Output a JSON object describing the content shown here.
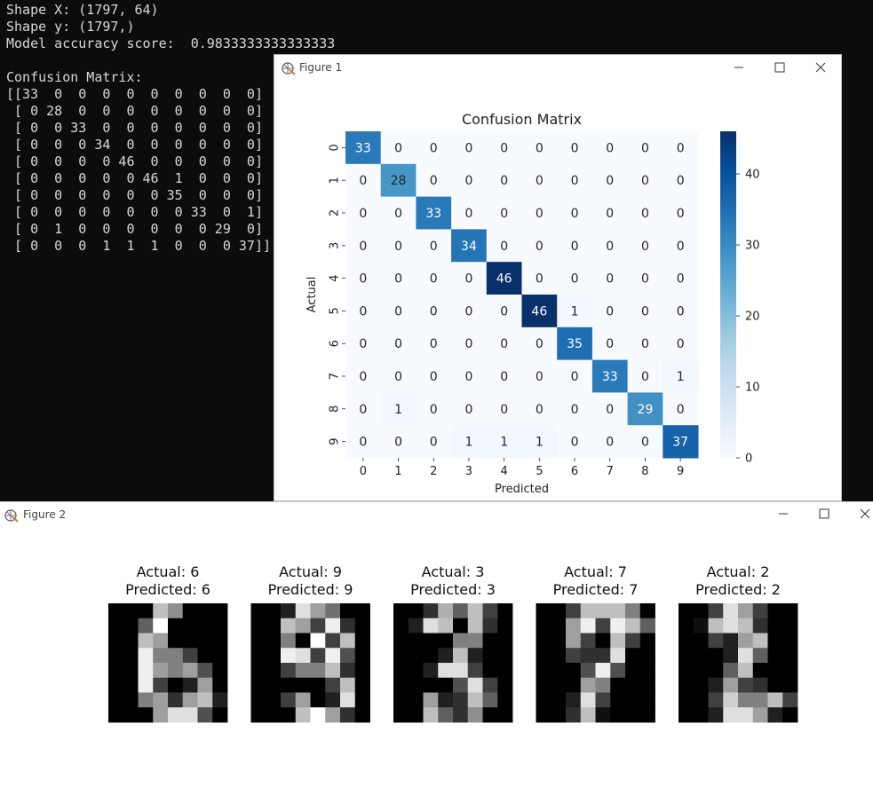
{
  "terminal": {
    "lines": [
      "Shape X: (1797, 64)",
      "Shape y: (1797,)",
      "Model accuracy score:  0.9833333333333333",
      "",
      "Confusion Matrix:",
      "[[33  0  0  0  0  0  0  0  0  0]",
      " [ 0 28  0  0  0  0  0  0  0  0]",
      " [ 0  0 33  0  0  0  0  0  0  0]",
      " [ 0  0  0 34  0  0  0  0  0  0]",
      " [ 0  0  0  0 46  0  0  0  0  0]",
      " [ 0  0  0  0  0 46  1  0  0  0]",
      " [ 0  0  0  0  0  0 35  0  0  0]",
      " [ 0  0  0  0  0  0  0 33  0  1]",
      " [ 0  1  0  0  0  0  0  0 29  0]",
      " [ 0  0  0  1  1  1  0  0  0 37]]"
    ]
  },
  "figure1": {
    "window_title": "Figure 1",
    "icons": [
      "figure-app-icon",
      "minimize-icon",
      "maximize-icon",
      "close-icon"
    ]
  },
  "figure2": {
    "window_title": "Figure 2",
    "icons": [
      "figure-app-icon",
      "minimize-icon",
      "maximize-icon",
      "close-icon"
    ],
    "panels": [
      {
        "actual": "Actual: 6",
        "predicted": "Predicted: 6",
        "pixels": [
          [
            0,
            0,
            0,
            12,
            9,
            0,
            0,
            0
          ],
          [
            0,
            0,
            6,
            16,
            0,
            0,
            0,
            0
          ],
          [
            0,
            0,
            12,
            10,
            0,
            0,
            0,
            0
          ],
          [
            0,
            0,
            15,
            8,
            8,
            4,
            0,
            0
          ],
          [
            0,
            0,
            15,
            10,
            8,
            10,
            5,
            0
          ],
          [
            0,
            0,
            15,
            4,
            0,
            2,
            10,
            0
          ],
          [
            0,
            0,
            8,
            10,
            3,
            10,
            12,
            2
          ],
          [
            0,
            0,
            0,
            10,
            14,
            14,
            5,
            0
          ]
        ]
      },
      {
        "actual": "Actual: 9",
        "predicted": "Predicted: 9",
        "pixels": [
          [
            0,
            0,
            2,
            14,
            10,
            7,
            0,
            0
          ],
          [
            0,
            0,
            12,
            10,
            4,
            15,
            3,
            0
          ],
          [
            0,
            0,
            8,
            0,
            16,
            4,
            12,
            0
          ],
          [
            0,
            0,
            15,
            14,
            4,
            15,
            5,
            0
          ],
          [
            0,
            0,
            4,
            8,
            8,
            12,
            3,
            0
          ],
          [
            0,
            0,
            0,
            0,
            0,
            4,
            12,
            0
          ],
          [
            0,
            0,
            4,
            10,
            0,
            2,
            14,
            0
          ],
          [
            0,
            0,
            0,
            12,
            16,
            10,
            3,
            0
          ]
        ]
      },
      {
        "actual": "Actual: 3",
        "predicted": "Predicted: 3",
        "pixels": [
          [
            0,
            0,
            3,
            11,
            6,
            12,
            4,
            0
          ],
          [
            0,
            2,
            14,
            12,
            0,
            12,
            3,
            0
          ],
          [
            0,
            0,
            0,
            0,
            8,
            8,
            0,
            0
          ],
          [
            0,
            0,
            0,
            2,
            12,
            2,
            0,
            0
          ],
          [
            0,
            0,
            2,
            14,
            14,
            4,
            0,
            0
          ],
          [
            0,
            0,
            0,
            0,
            5,
            14,
            4,
            0
          ],
          [
            0,
            0,
            10,
            2,
            3,
            12,
            6,
            0
          ],
          [
            0,
            0,
            12,
            6,
            3,
            9,
            0,
            0
          ]
        ]
      },
      {
        "actual": "Actual: 7",
        "predicted": "Predicted: 7",
        "pixels": [
          [
            0,
            0,
            4,
            12,
            12,
            12,
            8,
            0
          ],
          [
            0,
            0,
            10,
            15,
            4,
            15,
            12,
            6
          ],
          [
            0,
            0,
            10,
            4,
            0,
            12,
            4,
            0
          ],
          [
            0,
            0,
            4,
            3,
            3,
            14,
            0,
            0
          ],
          [
            0,
            0,
            0,
            5,
            15,
            5,
            0,
            0
          ],
          [
            0,
            0,
            0,
            10,
            8,
            0,
            0,
            0
          ],
          [
            0,
            0,
            2,
            14,
            4,
            0,
            0,
            0
          ],
          [
            0,
            0,
            3,
            12,
            1,
            0,
            0,
            0
          ]
        ]
      },
      {
        "actual": "Actual: 2",
        "predicted": "Predicted: 2",
        "pixels": [
          [
            0,
            0,
            4,
            14,
            10,
            4,
            0,
            0
          ],
          [
            0,
            1,
            12,
            14,
            12,
            3,
            0,
            0
          ],
          [
            0,
            0,
            4,
            2,
            10,
            12,
            0,
            0
          ],
          [
            0,
            0,
            0,
            2,
            14,
            6,
            0,
            0
          ],
          [
            0,
            0,
            0,
            6,
            12,
            0,
            0,
            0
          ],
          [
            0,
            0,
            2,
            10,
            4,
            3,
            0,
            0
          ],
          [
            0,
            0,
            4,
            13,
            8,
            8,
            12,
            4
          ],
          [
            0,
            0,
            2,
            14,
            14,
            10,
            2,
            0
          ]
        ]
      }
    ]
  },
  "chart_data": {
    "type": "heatmap",
    "title": "Confusion Matrix",
    "xlabel": "Predicted",
    "ylabel": "Actual",
    "x_categories": [
      "0",
      "1",
      "2",
      "3",
      "4",
      "5",
      "6",
      "7",
      "8",
      "9"
    ],
    "y_categories": [
      "0",
      "1",
      "2",
      "3",
      "4",
      "5",
      "6",
      "7",
      "8",
      "9"
    ],
    "values": [
      [
        33,
        0,
        0,
        0,
        0,
        0,
        0,
        0,
        0,
        0
      ],
      [
        0,
        28,
        0,
        0,
        0,
        0,
        0,
        0,
        0,
        0
      ],
      [
        0,
        0,
        33,
        0,
        0,
        0,
        0,
        0,
        0,
        0
      ],
      [
        0,
        0,
        0,
        34,
        0,
        0,
        0,
        0,
        0,
        0
      ],
      [
        0,
        0,
        0,
        0,
        46,
        0,
        0,
        0,
        0,
        0
      ],
      [
        0,
        0,
        0,
        0,
        0,
        46,
        1,
        0,
        0,
        0
      ],
      [
        0,
        0,
        0,
        0,
        0,
        0,
        35,
        0,
        0,
        0
      ],
      [
        0,
        0,
        0,
        0,
        0,
        0,
        0,
        33,
        0,
        1
      ],
      [
        0,
        1,
        0,
        0,
        0,
        0,
        0,
        0,
        29,
        0
      ],
      [
        0,
        0,
        0,
        1,
        1,
        1,
        0,
        0,
        0,
        37
      ]
    ],
    "colormap": "Blues",
    "colorbar": {
      "range": [
        0,
        46
      ],
      "ticks": [
        0,
        10,
        20,
        30,
        40
      ]
    },
    "annotated": true
  }
}
